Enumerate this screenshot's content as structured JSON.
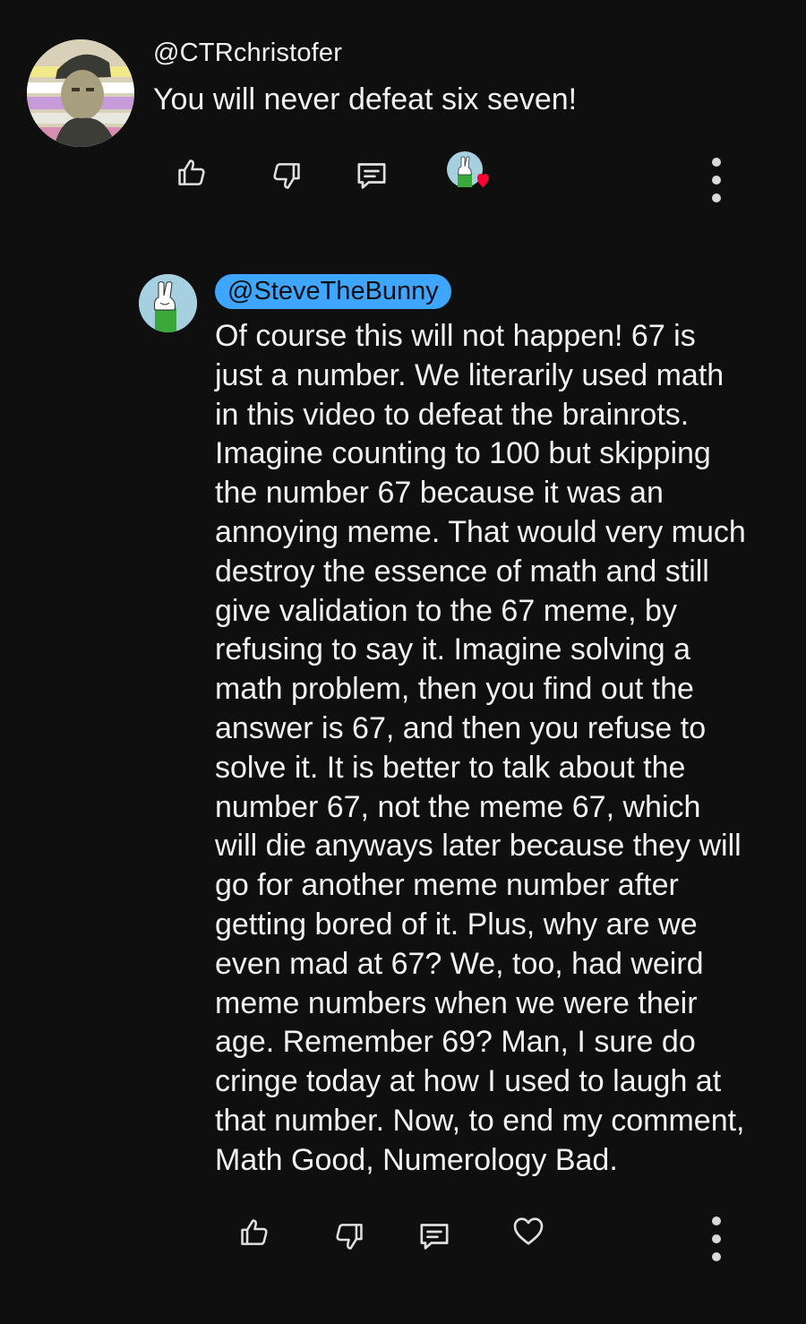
{
  "top_comment": {
    "author": "@CTRchristofer",
    "text": "You will never defeat six seven!",
    "actions": {
      "like_icon": "thumb-up-icon",
      "dislike_icon": "thumb-down-icon",
      "reply_icon": "comment-icon",
      "creator_heart_icon": "creator-heart-icon",
      "more_icon": "more-vert-icon"
    }
  },
  "reply": {
    "author": "@SteveTheBunny",
    "author_chip_color": "#3ea6ff",
    "lines": [
      "Of course this will not happen! 67 is",
      "just a number. We literarily used math",
      "in this video to defeat the brainrots.",
      "Imagine counting to 100 but skipping",
      "the number 67 because it was an",
      "annoying meme. That would very much",
      "destroy the essence of math and still",
      "give validation to the 67 meme, by",
      "refusing to say it. Imagine solving a",
      "math problem, then you find out the",
      "answer is 67, and then you refuse to",
      "solve it. It is better to talk about the",
      "number 67, not the meme 67, which",
      "will die anyways later because they will",
      "go for another meme number after",
      "getting bored of it. Plus, why are we",
      "even mad at 67? We, too, had weird",
      "meme numbers when we were their",
      "age. Remember 69? Man, I sure do",
      "cringe today at how I used to laugh at",
      "that number. Now, to end my comment,",
      "Math Good, Numerology Bad."
    ],
    "actions": {
      "like_icon": "thumb-up-icon",
      "dislike_icon": "thumb-down-icon",
      "reply_icon": "comment-icon",
      "heart_icon": "heart-outline-icon",
      "more_icon": "more-vert-icon"
    }
  },
  "colors": {
    "background": "#0f0f0f",
    "text": "#f1f1f1",
    "icon": "#e0e0e0",
    "heart_red": "#ff0033"
  }
}
